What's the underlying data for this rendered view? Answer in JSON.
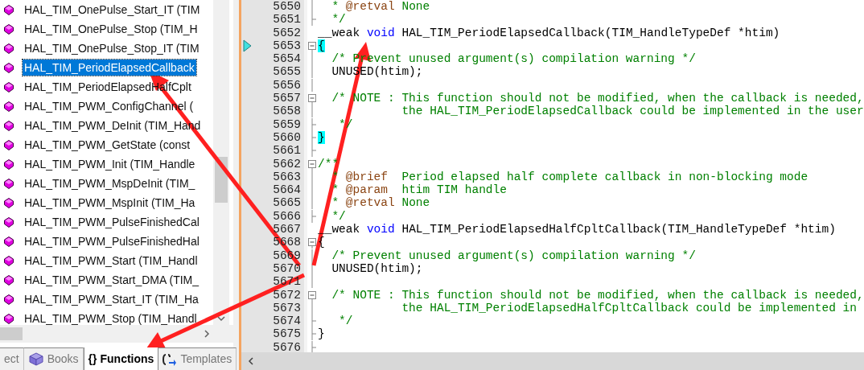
{
  "function_list": {
    "items": [
      {
        "label": "HAL_TIM_OnePulse_Start_IT (TIM",
        "selected": false
      },
      {
        "label": "HAL_TIM_OnePulse_Stop (TIM_H",
        "selected": false
      },
      {
        "label": "HAL_TIM_OnePulse_Stop_IT (TIM",
        "selected": false
      },
      {
        "label": "HAL_TIM_PeriodElapsedCallback",
        "selected": true
      },
      {
        "label": "HAL_TIM_PeriodElapsedHalfCplt",
        "selected": false
      },
      {
        "label": "HAL_TIM_PWM_ConfigChannel (",
        "selected": false
      },
      {
        "label": "HAL_TIM_PWM_DeInit (TIM_Hand",
        "selected": false
      },
      {
        "label": "HAL_TIM_PWM_GetState (const",
        "selected": false
      },
      {
        "label": "HAL_TIM_PWM_Init (TIM_Handle",
        "selected": false
      },
      {
        "label": "HAL_TIM_PWM_MspDeInit (TIM_",
        "selected": false
      },
      {
        "label": "HAL_TIM_PWM_MspInit (TIM_Ha",
        "selected": false
      },
      {
        "label": "HAL_TIM_PWM_PulseFinishedCal",
        "selected": false
      },
      {
        "label": "HAL_TIM_PWM_PulseFinishedHal",
        "selected": false
      },
      {
        "label": "HAL_TIM_PWM_Start (TIM_Handl",
        "selected": false
      },
      {
        "label": "HAL_TIM_PWM_Start_DMA (TIM_",
        "selected": false
      },
      {
        "label": "HAL_TIM_PWM_Start_IT (TIM_Ha",
        "selected": false
      },
      {
        "label": "HAL_TIM_PWM_Stop (TIM_Handl",
        "selected": false
      }
    ]
  },
  "panel_tabs": [
    {
      "label": "ect",
      "selected": false,
      "kind": "plain"
    },
    {
      "label": "Books",
      "selected": false,
      "kind": "book"
    },
    {
      "label": "Functions",
      "selected": true,
      "kind": "glyph",
      "glyph": "{}"
    },
    {
      "label": "Templates",
      "selected": false,
      "kind": "template"
    }
  ],
  "editor": {
    "lines": [
      {
        "number": "5650",
        "kind": "line",
        "current": false,
        "tokens": [
          {
            "text": "  * ",
            "kind": "comment"
          },
          {
            "text": "@retval",
            "kind": "doc_tag"
          },
          {
            "text": " None",
            "kind": "comment"
          }
        ]
      },
      {
        "number": "5651",
        "kind": "end",
        "current": false,
        "tokens": [
          {
            "text": "  */",
            "kind": "comment"
          }
        ]
      },
      {
        "number": "5652",
        "kind": "none",
        "current": false,
        "tokens": [
          {
            "text": "__weak ",
            "kind": "plain"
          },
          {
            "text": "void",
            "kind": "keyword"
          },
          {
            "text": " HAL_TIM_PeriodElapsedCallback(TIM_HandleTypeDef *htim)",
            "kind": "plain"
          }
        ]
      },
      {
        "number": "5653",
        "kind": "box",
        "current": true,
        "tokens": [
          {
            "text": "{",
            "kind": "brace_match"
          }
        ]
      },
      {
        "number": "5654",
        "kind": "line",
        "current": false,
        "tokens": [
          {
            "text": "  /* Prevent unused argument(s) compilation warning */",
            "kind": "comment"
          }
        ]
      },
      {
        "number": "5655",
        "kind": "line",
        "current": false,
        "tokens": [
          {
            "text": "  UNUSED(htim);",
            "kind": "plain"
          }
        ]
      },
      {
        "number": "5656",
        "kind": "line",
        "current": false
      },
      {
        "number": "5657",
        "kind": "box",
        "current": false,
        "tokens": [
          {
            "text": "  /* NOTE : This function should not be modified, when the callback is needed,",
            "kind": "comment"
          }
        ]
      },
      {
        "number": "5658",
        "kind": "line",
        "current": false,
        "tokens": [
          {
            "text": "            the HAL_TIM_PeriodElapsedCallback could be implemented in the user",
            "kind": "comment"
          }
        ]
      },
      {
        "number": "5659",
        "kind": "end",
        "current": false,
        "tokens": [
          {
            "text": "   */",
            "kind": "comment"
          }
        ]
      },
      {
        "number": "5660",
        "kind": "end",
        "current": false,
        "tokens": [
          {
            "text": "}",
            "kind": "brace_match"
          }
        ]
      },
      {
        "number": "5661",
        "kind": "end",
        "current": false
      },
      {
        "number": "5662",
        "kind": "box",
        "current": false,
        "tokens": [
          {
            "text": "/**",
            "kind": "comment"
          }
        ]
      },
      {
        "number": "5663",
        "kind": "line",
        "current": false,
        "tokens": [
          {
            "text": "  * ",
            "kind": "comment"
          },
          {
            "text": "@brief",
            "kind": "doc_tag"
          },
          {
            "text": "  Period elapsed half complete callback in non-blocking mode",
            "kind": "comment"
          }
        ]
      },
      {
        "number": "5664",
        "kind": "line",
        "current": false,
        "tokens": [
          {
            "text": "  * ",
            "kind": "comment"
          },
          {
            "text": "@param",
            "kind": "doc_tag"
          },
          {
            "text": "  htim TIM handle",
            "kind": "comment"
          }
        ]
      },
      {
        "number": "5665",
        "kind": "line",
        "current": false,
        "tokens": [
          {
            "text": "  * ",
            "kind": "comment"
          },
          {
            "text": "@retval",
            "kind": "doc_tag"
          },
          {
            "text": " None",
            "kind": "comment"
          }
        ]
      },
      {
        "number": "5666",
        "kind": "end",
        "current": false,
        "tokens": [
          {
            "text": "  */",
            "kind": "comment"
          }
        ]
      },
      {
        "number": "5667",
        "kind": "none",
        "current": false,
        "tokens": [
          {
            "text": "__weak ",
            "kind": "plain"
          },
          {
            "text": "void",
            "kind": "keyword"
          },
          {
            "text": " HAL_TIM_PeriodElapsedHalfCpltCallback(TIM_HandleTypeDef *htim)",
            "kind": "plain"
          }
        ]
      },
      {
        "number": "5668",
        "kind": "box",
        "current": false,
        "tokens": [
          {
            "text": "{",
            "kind": "plain"
          }
        ]
      },
      {
        "number": "5669",
        "kind": "line",
        "current": false,
        "tokens": [
          {
            "text": "  /* Prevent unused argument(s) compilation warning */",
            "kind": "comment"
          }
        ]
      },
      {
        "number": "5670",
        "kind": "line",
        "current": false,
        "tokens": [
          {
            "text": "  UNUSED(htim);",
            "kind": "plain"
          }
        ]
      },
      {
        "number": "5671",
        "kind": "line",
        "current": false
      },
      {
        "number": "5672",
        "kind": "box",
        "current": false,
        "tokens": [
          {
            "text": "  /* NOTE : This function should not be modified, when the callback is needed,",
            "kind": "comment"
          }
        ]
      },
      {
        "number": "5673",
        "kind": "line",
        "current": false,
        "tokens": [
          {
            "text": "            the HAL_TIM_PeriodElapsedHalfCpltCallback could be implemented in",
            "kind": "comment"
          }
        ]
      },
      {
        "number": "5674",
        "kind": "end",
        "current": false,
        "tokens": [
          {
            "text": "   */",
            "kind": "comment"
          }
        ]
      },
      {
        "number": "5675",
        "kind": "end",
        "current": false,
        "tokens": [
          {
            "text": "}",
            "kind": "plain"
          }
        ]
      },
      {
        "number": "5676",
        "kind": "end",
        "current": false
      }
    ]
  }
}
